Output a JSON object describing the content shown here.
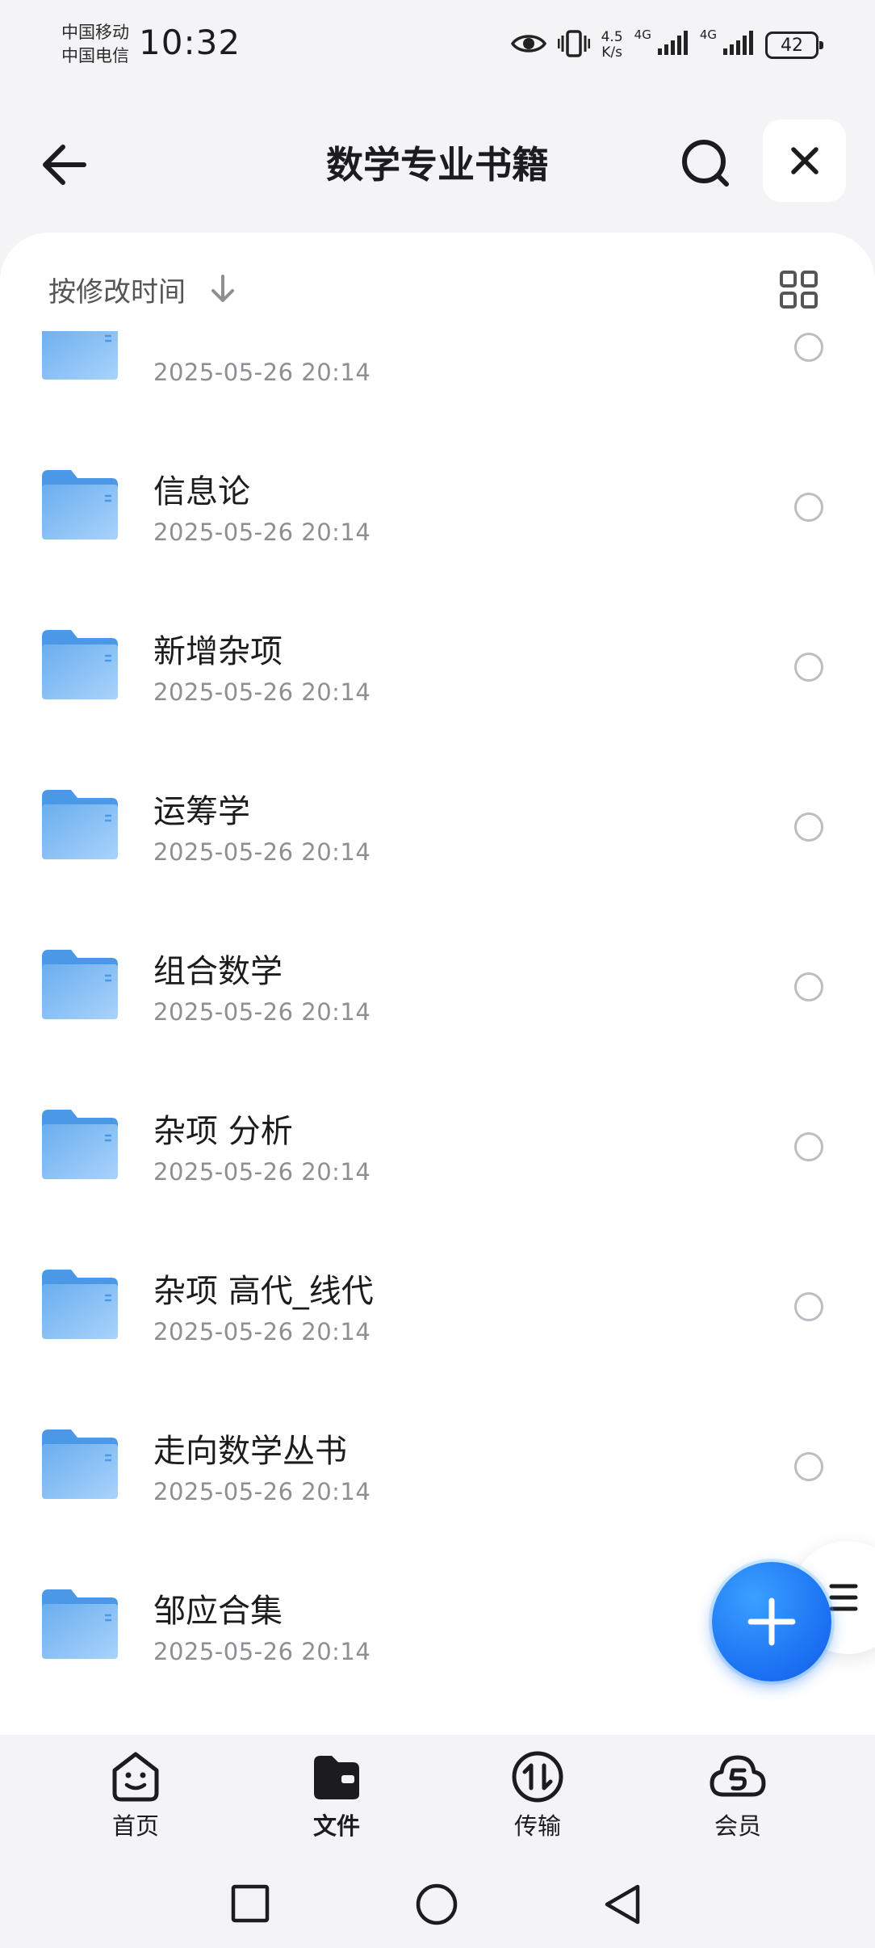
{
  "status_bar": {
    "carrier_1": "中国移动",
    "carrier_2": "中国电信",
    "time": "10:32",
    "net_speed_value": "4.5",
    "net_speed_unit": "K/s",
    "sim1_label": "4G",
    "sim2_label": "4G",
    "battery": "42",
    "icons": [
      "eye-icon",
      "vibrate-icon",
      "signal-icon",
      "signal-icon",
      "battery-icon"
    ]
  },
  "header": {
    "title": "数学专业书籍",
    "icons": [
      "back-arrow-icon",
      "search-icon",
      "close-icon"
    ]
  },
  "sort": {
    "label": "按修改时间",
    "direction_icon": "arrow-down-icon",
    "view_toggle_icon": "grid-view-icon"
  },
  "files": [
    {
      "name": "",
      "date": "2025-05-26 20:14"
    },
    {
      "name": "信息论",
      "date": "2025-05-26 20:14"
    },
    {
      "name": "新增杂项",
      "date": "2025-05-26 20:14"
    },
    {
      "name": "运筹学",
      "date": "2025-05-26 20:14"
    },
    {
      "name": "组合数学",
      "date": "2025-05-26 20:14"
    },
    {
      "name": "杂项 分析",
      "date": "2025-05-26 20:14"
    },
    {
      "name": "杂项 高代_线代",
      "date": "2025-05-26 20:14"
    },
    {
      "name": "走向数学丛书",
      "date": "2025-05-26 20:14"
    },
    {
      "name": "邹应合集",
      "date": "2025-05-26 20:14"
    }
  ],
  "fab": {
    "icon": "plus-icon"
  },
  "bottom_nav": {
    "home": "首页",
    "files": "文件",
    "transfer": "传输",
    "vip": "会员",
    "active": "文件"
  },
  "colors": {
    "accent": "#1a6ff2",
    "folder": "#62a9ee",
    "background": "#f4f4f6"
  }
}
